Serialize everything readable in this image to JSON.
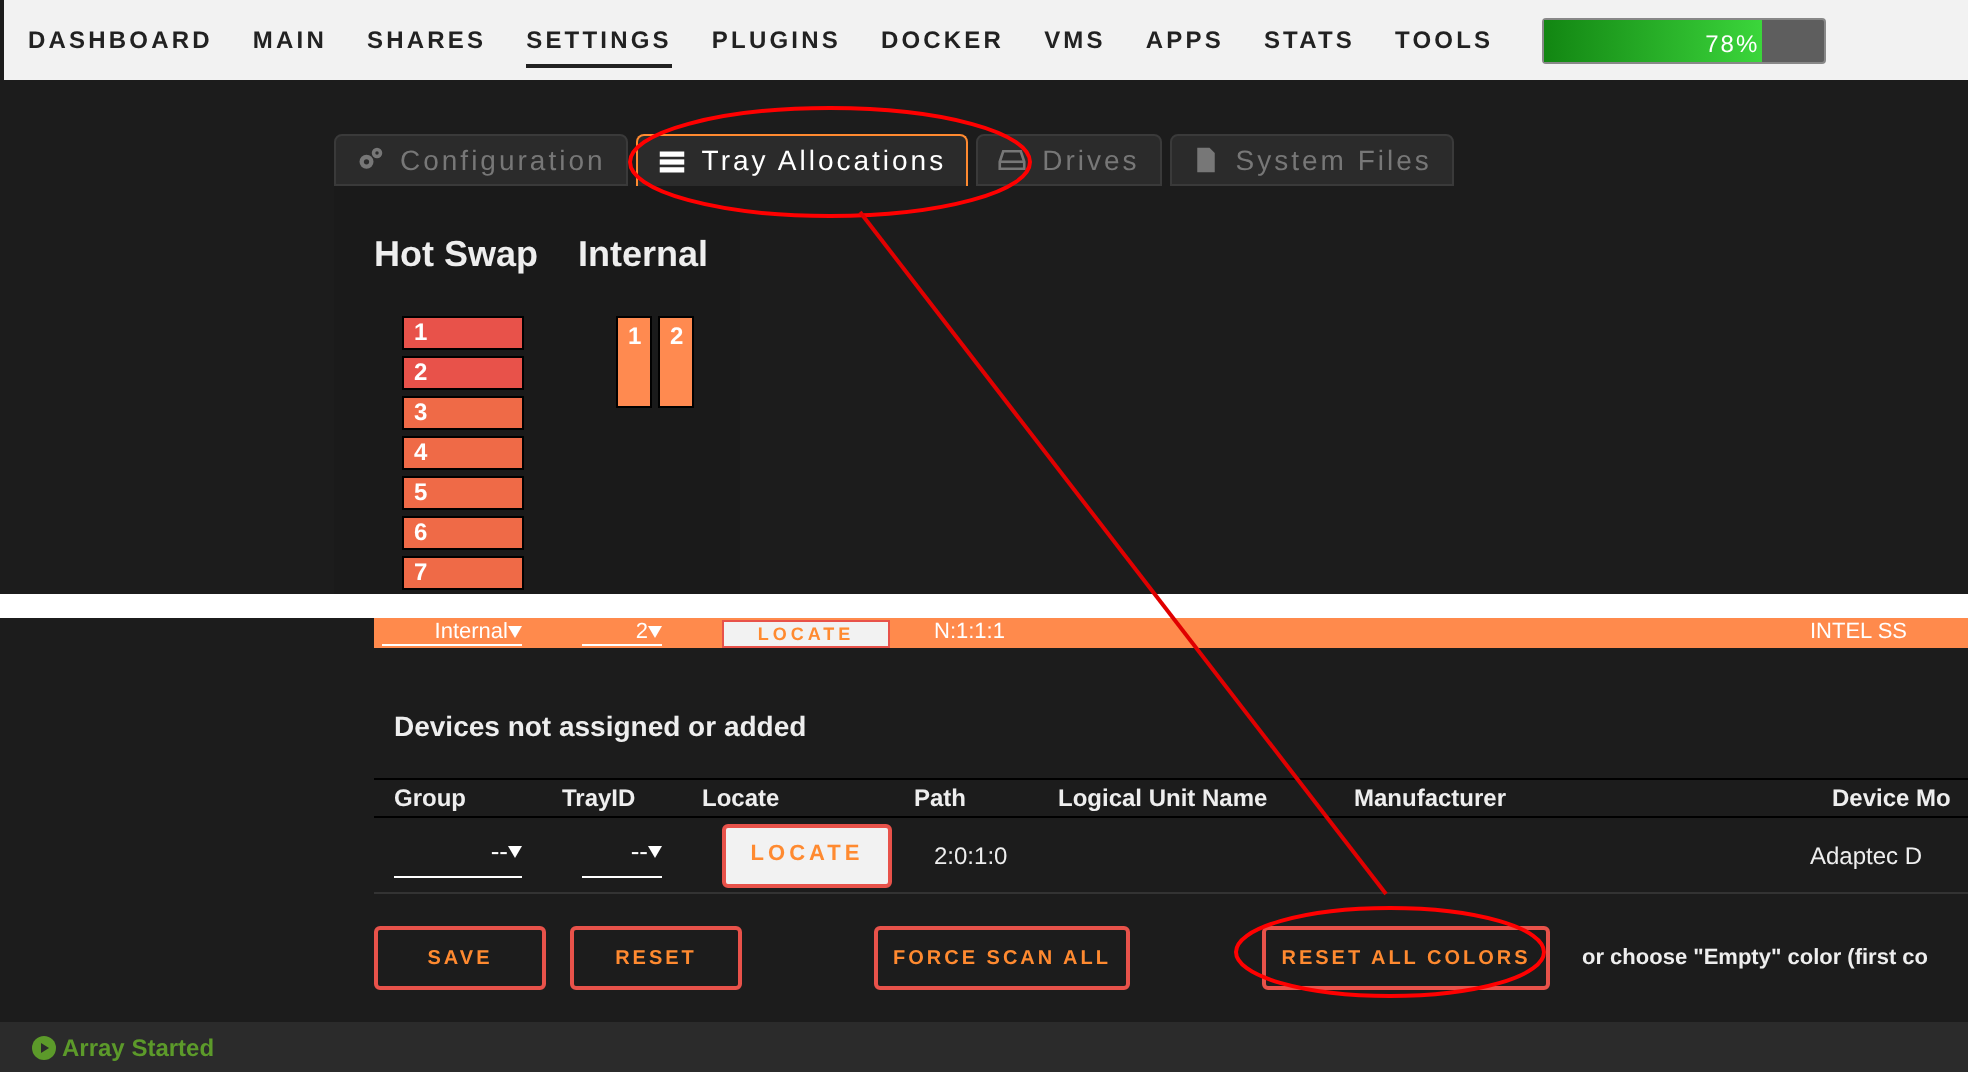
{
  "nav": {
    "items": [
      {
        "label": "DASHBOARD",
        "selected": false
      },
      {
        "label": "MAIN",
        "selected": false
      },
      {
        "label": "SHARES",
        "selected": false
      },
      {
        "label": "SETTINGS",
        "selected": true
      },
      {
        "label": "PLUGINS",
        "selected": false
      },
      {
        "label": "DOCKER",
        "selected": false
      },
      {
        "label": "VMS",
        "selected": false
      },
      {
        "label": "APPS",
        "selected": false
      },
      {
        "label": "STATS",
        "selected": false
      },
      {
        "label": "TOOLS",
        "selected": false
      }
    ],
    "usage": {
      "level": 0.78,
      "reading": "78%"
    }
  },
  "tabs": [
    {
      "label": "Configuration",
      "kind": "gears",
      "selected": false
    },
    {
      "label": "Tray Allocations",
      "kind": "server",
      "selected": true
    },
    {
      "label": "Drives",
      "kind": "drive",
      "selected": false
    },
    {
      "label": "System Files",
      "kind": "file",
      "selected": false
    }
  ],
  "trays": [
    {
      "title": "Hot Swap",
      "kind": "row",
      "slots": [
        {
          "label": "1",
          "color": "#e8524a"
        },
        {
          "label": "2",
          "color": "#e8524a"
        },
        {
          "label": "3",
          "color": "#ef6a47"
        },
        {
          "label": "4",
          "color": "#ef6a47"
        },
        {
          "label": "5",
          "color": "#ef6a47"
        },
        {
          "label": "6",
          "color": "#ef6a47"
        },
        {
          "label": "7",
          "color": "#ef6a47"
        }
      ]
    },
    {
      "title": "Internal",
      "kind": "column",
      "slots": [
        {
          "label": "1",
          "color": "#ff8a50"
        },
        {
          "label": "2",
          "color": "#ff8a50"
        }
      ]
    }
  ],
  "assigned_row": {
    "group": "Internal",
    "tray_id": "2",
    "locate": "LOCATE",
    "path": "N:1:1:1",
    "device_model": "INTEL SS"
  },
  "unassigned": {
    "title": "Devices not assigned or added",
    "columns": [
      "Group",
      "TrayID",
      "Locate",
      "Path",
      "Logical Unit Name",
      "Manufacturer",
      "Device Mo"
    ],
    "rows": [
      {
        "group": "--",
        "tray_id": "--",
        "locate": "LOCATE",
        "path": "2:0:1:0",
        "device_model": "Adaptec D"
      }
    ]
  },
  "buttons": [
    "SAVE",
    "RESET",
    "FORCE SCAN ALL",
    "RESET ALL COLORS"
  ],
  "hint": "or choose \"Empty\" color (first co",
  "status_bar": {
    "text": "Array Started"
  }
}
